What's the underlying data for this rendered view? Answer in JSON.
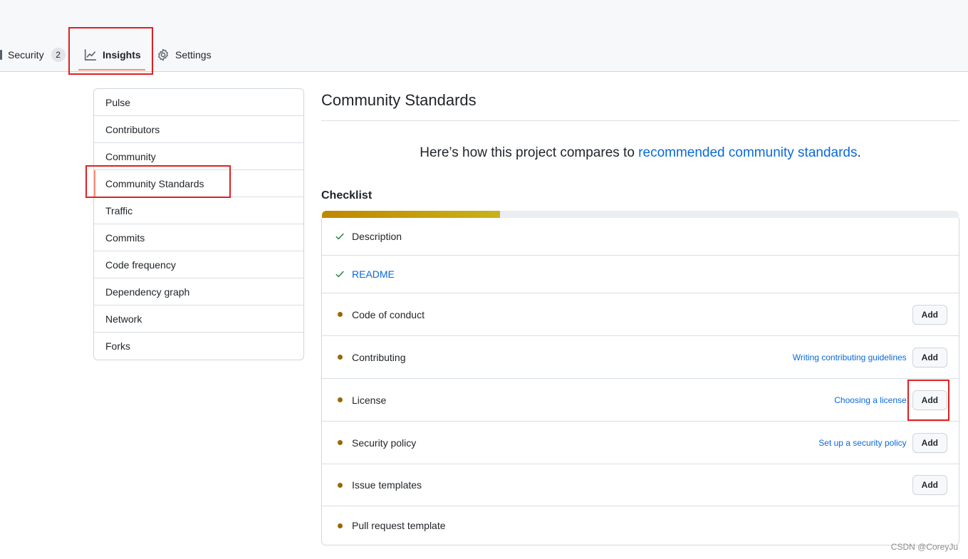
{
  "tabs": {
    "security": {
      "label": "Security",
      "count": "2"
    },
    "insights": {
      "label": "Insights"
    },
    "settings": {
      "label": "Settings"
    }
  },
  "sidebar": {
    "items": [
      {
        "label": "Pulse"
      },
      {
        "label": "Contributors"
      },
      {
        "label": "Community"
      },
      {
        "label": "Community Standards",
        "selected": true
      },
      {
        "label": "Traffic"
      },
      {
        "label": "Commits"
      },
      {
        "label": "Code frequency"
      },
      {
        "label": "Dependency graph"
      },
      {
        "label": "Network"
      },
      {
        "label": "Forks"
      }
    ]
  },
  "main": {
    "title": "Community Standards",
    "intro_text": "Here’s how this project compares to ",
    "intro_link": "recommended community standards",
    "intro_end": ".",
    "checklist_heading": "Checklist",
    "progress": 0.28,
    "items": [
      {
        "label": "Description",
        "status": "done"
      },
      {
        "label": "README",
        "status": "done"
      },
      {
        "label": "Code of conduct",
        "status": "missing",
        "button": "Add"
      },
      {
        "label": "Contributing",
        "status": "missing",
        "guide": "Writing contributing guidelines",
        "button": "Add"
      },
      {
        "label": "License",
        "status": "missing",
        "guide": "Choosing a license",
        "button": "Add"
      },
      {
        "label": "Security policy",
        "status": "missing",
        "guide": "Set up a security policy",
        "button": "Add"
      },
      {
        "label": "Issue templates",
        "status": "missing",
        "button": "Add"
      },
      {
        "label": "Pull request template",
        "status": "missing"
      }
    ]
  },
  "colors": {
    "link": "#0969da",
    "check": "#1a7f37",
    "pending_dot": "#9a6700",
    "progress_start": "#bf8700",
    "progress_end": "#c9b21a",
    "annotation_box": "#e02020",
    "tab_underline": "#fd8c73"
  },
  "watermark": "CSDN @CoreyJu"
}
